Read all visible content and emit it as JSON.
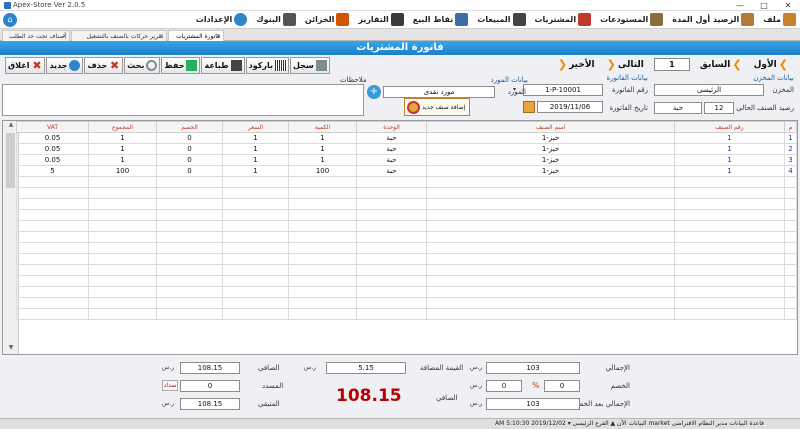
{
  "window": {
    "title": "Apex-Store Ver 2.0.5",
    "controls": [
      "—",
      "□",
      "✕"
    ]
  },
  "menu": [
    {
      "label": "ملف",
      "icon": "file-icon",
      "color": "#c9812e"
    },
    {
      "label": "الرصيد أول المدة",
      "icon": "opening-balance-icon",
      "color": "#b07a38"
    },
    {
      "label": "المستودعات",
      "icon": "warehouse-icon",
      "color": "#8a6d3b"
    },
    {
      "label": "المشتريات",
      "icon": "cart-icon",
      "color": "#c0392b"
    },
    {
      "label": "المبيعات",
      "icon": "register-icon",
      "color": "#444444"
    },
    {
      "label": "نقاط البيع",
      "icon": "pos-icon",
      "color": "#3a6ea5"
    },
    {
      "label": "التقارير",
      "icon": "reports-icon",
      "color": "#3a3a3a"
    },
    {
      "label": "الخزائن",
      "icon": "safe-icon",
      "color": "#d35400"
    },
    {
      "label": "البنوك",
      "icon": "bank-icon",
      "color": "#555555"
    },
    {
      "label": "الإعدادات",
      "icon": "settings-icon",
      "color": "#2d86c9"
    }
  ],
  "tabs": [
    {
      "label": "فاتورة المشتريات",
      "active": true
    },
    {
      "label": "تقرير حركات بالصنف بالتشغيل",
      "active": false
    },
    {
      "label": "أصناف تحت حد الطلب",
      "active": false
    }
  ],
  "page_title": "فاتورة المشتريات",
  "toolbar": [
    {
      "label": "سجل",
      "icon": "save-record-icon",
      "color": "#7f8c8d"
    },
    {
      "label": "باركود",
      "icon": "barcode-icon",
      "color": "#555555"
    },
    {
      "label": "طباعة",
      "icon": "printer-icon",
      "color": "#444444"
    },
    {
      "label": "حفظ",
      "icon": "floppy-icon",
      "color": "#27ae60"
    },
    {
      "label": "بحث",
      "icon": "magnifier-icon",
      "color": "#7f8c8d"
    },
    {
      "label": "حذف",
      "icon": "delete-icon",
      "color": "#c0392b"
    },
    {
      "label": "جديد",
      "icon": "new-icon",
      "color": "#2d86c9"
    },
    {
      "label": "اغلاق",
      "icon": "close-icon",
      "color": "#c0392b"
    }
  ],
  "nav": {
    "first": "الأول",
    "prev": "السابق",
    "page": "1",
    "next": "التالى",
    "last": "الأخير"
  },
  "store": {
    "section_label": "بيانات المخزن",
    "store_label": "المخزن",
    "store_value": "الرئيسى",
    "balance_label": "رصيد الصنف الحالى",
    "balance_value": "12",
    "balance_unit": "حبة"
  },
  "invoice": {
    "section_label": "بيانات الفاتورة",
    "number_label": "رقم الفاتورة",
    "number_value": "1-P-10001",
    "date_label": "تاريخ الفاتورة",
    "date_value": "2019/11/06"
  },
  "supplier": {
    "section_label": "بيانات المورد",
    "supplier_label": "المورد",
    "supplier_value": "مورد نقدى",
    "new_item_label": "إضافة صنف جديد"
  },
  "notes": {
    "label": "ملاحظات",
    "value": ""
  },
  "grid": {
    "columns": [
      "م",
      "رقم الصنف",
      "اسم الصنف",
      "الوحدة",
      "الكمية",
      "السعر",
      "الخصم",
      "المجموع",
      "VAT"
    ],
    "rows": [
      [
        "1",
        "1",
        "خبز-1",
        "حبة",
        "1",
        "1",
        "0",
        "1",
        "0.05"
      ],
      [
        "2",
        "1",
        "خبز-1",
        "حبة",
        "1",
        "1",
        "0",
        "1",
        "0.05"
      ],
      [
        "3",
        "1",
        "خبز-1",
        "حبة",
        "1",
        "1",
        "0",
        "1",
        "0.05"
      ],
      [
        "4",
        "1",
        "خبز-1",
        "حبة",
        "100",
        "1",
        "0",
        "100",
        "5"
      ]
    ]
  },
  "summary": {
    "total_label": "الإجمالي",
    "total_value": "103",
    "discount_label": "الخصم",
    "discount_value": "0",
    "discount_pct": "0",
    "pct_sign": "%",
    "after_discount_label": "الإجمالي بعد الخصم",
    "after_discount_value": "103",
    "vat_label": "القيمة المضافة",
    "vat_value": "5.15",
    "net_label": "الصافى",
    "net_value": "108.15",
    "paid_label": "المسدد",
    "paid_value": "0",
    "paid_button": "سداد",
    "remaining_label": "المتبقى",
    "remaining_value": "108.15",
    "net_bottom_label": "الصافي",
    "big_total": "108.15",
    "currency": "ر.س"
  },
  "status": "AM 5:10:30 2019/12/02   ▾ البيانات الآن  ▲  الفرع الرئيسى  market  قاعدة البيانات  مدير النظام الافتراضى"
}
